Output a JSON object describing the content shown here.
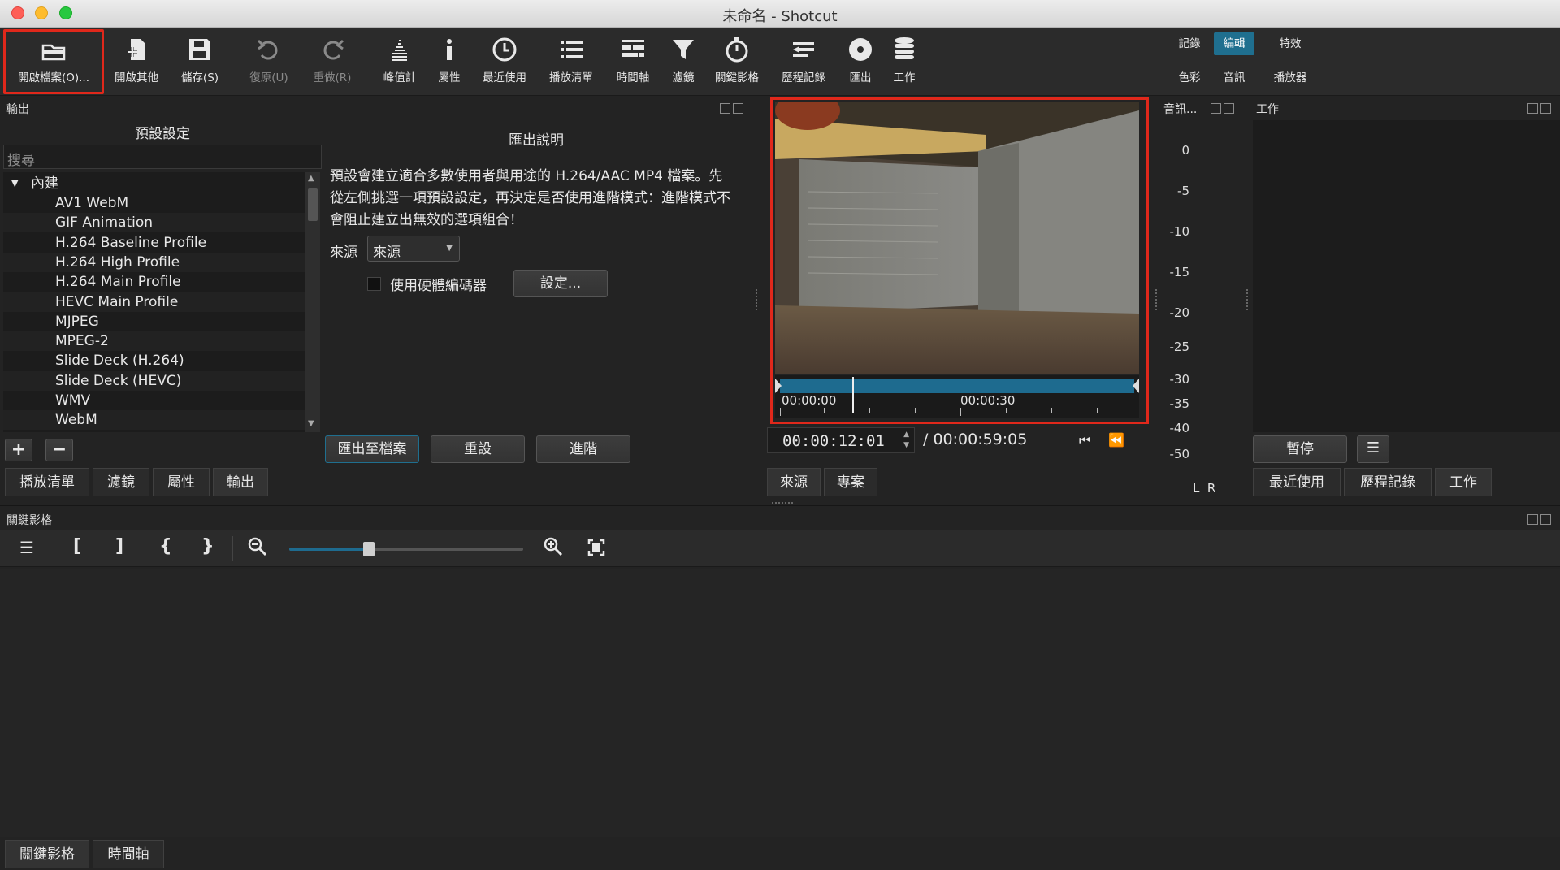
{
  "window": {
    "title": "未命名 - Shotcut"
  },
  "colors": {
    "accent": "#1f6f8f",
    "highlight_border": "#e0281b",
    "progress_bar": "#1e6b8f"
  },
  "toolbar": {
    "buttons": [
      {
        "label": "開啟檔案(O)...",
        "icon": "folder-open-icon"
      },
      {
        "label": "開啟其他",
        "icon": "open-other-icon"
      },
      {
        "label": "儲存(S)",
        "icon": "save-icon"
      },
      {
        "label": "復原(U)",
        "icon": "undo-icon"
      },
      {
        "label": "重做(R)",
        "icon": "redo-icon"
      },
      {
        "label": "峰值計",
        "icon": "peak-meter-icon"
      },
      {
        "label": "屬性",
        "icon": "info-icon"
      },
      {
        "label": "最近使用",
        "icon": "clock-icon"
      },
      {
        "label": "播放清單",
        "icon": "list-icon"
      },
      {
        "label": "時間軸",
        "icon": "timeline-icon"
      },
      {
        "label": "濾鏡",
        "icon": "filter-icon"
      },
      {
        "label": "關鍵影格",
        "icon": "stopwatch-icon"
      },
      {
        "label": "歷程記錄",
        "icon": "history-icon"
      },
      {
        "label": "匯出",
        "icon": "export-disc-icon"
      },
      {
        "label": "工作",
        "icon": "jobs-stack-icon"
      }
    ],
    "workspaces": {
      "row1": [
        "記錄",
        "編輯",
        "特效"
      ],
      "row2": [
        "色彩",
        "音訊",
        "播放器"
      ],
      "active": "編輯"
    }
  },
  "export_panel": {
    "title": "輸出",
    "presets_header": "預設設定",
    "search_placeholder": "搜尋",
    "group_label": "內建",
    "presets": [
      "AV1 WebM",
      "GIF Animation",
      "H.264 Baseline Profile",
      "H.264 High Profile",
      "H.264 Main Profile",
      "HEVC Main Profile",
      "MJPEG",
      "MPEG-2",
      "Slide Deck (H.264)",
      "Slide Deck (HEVC)",
      "WMV",
      "WebM"
    ],
    "description_title": "匯出說明",
    "description": "預設會建立適合多數使用者與用途的 H.264/AAC MP4 檔案。先從左側挑選一項預設設定，再決定是否使用進階模式：進階模式不會阻止建立出無效的選項組合！",
    "source_label": "來源",
    "source_value": "來源",
    "hw_encoder_label": "使用硬體編碼器",
    "settings_button": "設定...",
    "export_file_button": "匯出至檔案",
    "reset_button": "重設",
    "advanced_button": "進階",
    "add_icon": "plus-icon",
    "remove_icon": "minus-icon"
  },
  "left_tabs": [
    "播放清單",
    "濾鏡",
    "屬性",
    "輸出"
  ],
  "player": {
    "timecode_current": "00:00:12:01",
    "timecode_total": "/ 00:00:59:05",
    "ruler_labels": [
      "00:00:00",
      "00:00:30"
    ],
    "playhead_fraction": 0.204,
    "tabs": [
      "來源",
      "專案"
    ]
  },
  "audio_panel": {
    "title": "音訊...",
    "scale": [
      "0",
      "-5",
      "-10",
      "-15",
      "-20",
      "-25",
      "-30",
      "-35",
      "-40",
      "-50"
    ],
    "channels": "L  R"
  },
  "jobs_panel": {
    "title": "工作",
    "pause_button": "暫停",
    "menu_icon": "hamburger-icon",
    "tabs": [
      "最近使用",
      "歷程記錄",
      "工作"
    ]
  },
  "keyframes_panel": {
    "title": "關鍵影格",
    "zoom_fraction": 0.34,
    "bottom_tabs": [
      "關鍵影格",
      "時間軸"
    ]
  }
}
